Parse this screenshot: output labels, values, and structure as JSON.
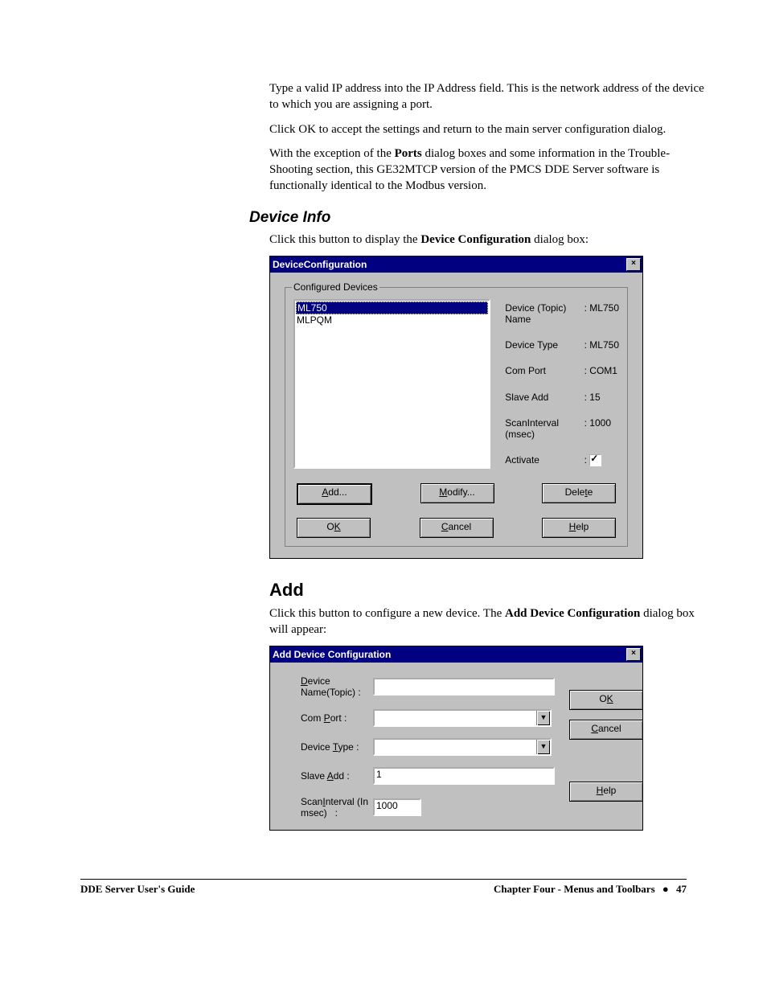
{
  "intro": {
    "p1": "Type a valid IP address into the IP Address field. This is the network address of the device to which you are assigning a port.",
    "p2": "Click OK to accept the settings and return to the main server configuration dialog.",
    "p3a": "With the exception of the ",
    "p3_bold": "Ports",
    "p3b": " dialog boxes and some information in the Trouble-Shooting section, this GE32MTCP version of the PMCS DDE Server software is functionally identical to the Modbus version."
  },
  "device_info": {
    "heading": "Device Info",
    "intro_a": "Click this button to display the ",
    "intro_bold": "Device Configuration",
    "intro_b": " dialog box:"
  },
  "dlg1": {
    "title": "DeviceConfiguration",
    "group_label": "Configured  Devices",
    "list": [
      "ML750",
      "MLPQM"
    ],
    "fields": {
      "name_label": "Device (Topic) Name",
      "name_value": "ML750",
      "type_label": "Device Type",
      "type_value": "ML750",
      "comport_label": "Com Port",
      "comport_value": "COM1",
      "slave_label": "Slave Add",
      "slave_value": "15",
      "scan_label": "ScanInterval (msec)",
      "scan_value": "1000",
      "activate_label": "Activate"
    },
    "buttons": {
      "add": "Add...",
      "modify": "Modify...",
      "delete": "Delete",
      "ok": "OK",
      "cancel": "Cancel",
      "help": "Help"
    }
  },
  "add_section": {
    "heading": "Add",
    "intro_a": "Click this button to configure a new device. The ",
    "intro_bold": "Add Device Configuration",
    "intro_b": " dialog box will appear:"
  },
  "dlg2": {
    "title": "Add Device Configuration",
    "labels": {
      "device_name": "Device Name(Topic) :",
      "com_port": "Com Port :",
      "device_type": "Device Type :",
      "slave_add": "Slave Add :",
      "scan_interval": "ScanInterval (In msec)    :"
    },
    "values": {
      "device_name": "",
      "com_port": "",
      "device_type": "",
      "slave_add": "1",
      "scan_interval": "1000"
    },
    "buttons": {
      "ok": "OK",
      "cancel": "Cancel",
      "help": "Help"
    }
  },
  "footer": {
    "left": "DDE Server User's Guide",
    "right": "Chapter Four - Menus and Toolbars",
    "dot": "●",
    "page": "47"
  }
}
